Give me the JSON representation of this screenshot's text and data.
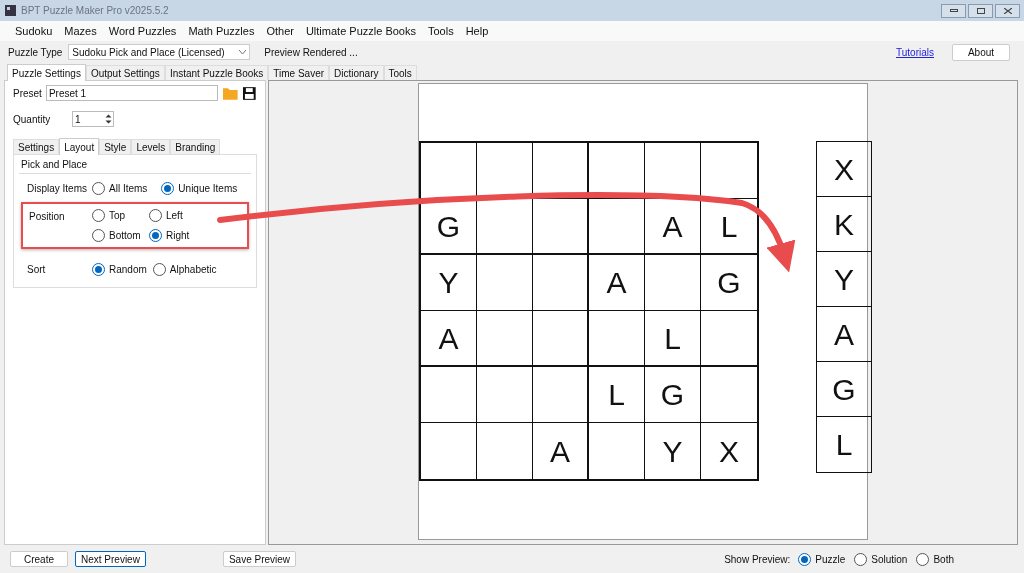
{
  "window": {
    "title": "BPT Puzzle Maker Pro v2025.5.2"
  },
  "menu": [
    "Sudoku",
    "Mazes",
    "Word Puzzles",
    "Math Puzzles",
    "Other",
    "Ultimate Puzzle Books",
    "Tools",
    "Help"
  ],
  "toolbar": {
    "puzzle_type_label": "Puzzle Type",
    "puzzle_type": "Sudoku Pick and Place (Licensed)",
    "status": "Preview Rendered ...",
    "tutorials_link": "Tutorials",
    "about_button": "About"
  },
  "main_tabs": [
    {
      "label": "Puzzle Settings",
      "selected": true
    },
    {
      "label": "Output Settings",
      "selected": false
    },
    {
      "label": "Instant Puzzle Books",
      "selected": false
    },
    {
      "label": "Time Saver",
      "selected": false
    },
    {
      "label": "Dictionary",
      "selected": false
    },
    {
      "label": "Tools",
      "selected": false
    }
  ],
  "preset": {
    "label": "Preset",
    "value": "Preset 1"
  },
  "quantity": {
    "label": "Quantity",
    "value": "1"
  },
  "sub_tabs": [
    {
      "label": "Settings",
      "selected": false
    },
    {
      "label": "Layout",
      "selected": true
    },
    {
      "label": "Style",
      "selected": false
    },
    {
      "label": "Levels",
      "selected": false
    },
    {
      "label": "Branding",
      "selected": false
    }
  ],
  "group": {
    "title": "Pick and Place",
    "display_items": {
      "label": "Display Items",
      "options": [
        {
          "label": "All Items",
          "selected": false
        },
        {
          "label": "Unique Items",
          "selected": true
        }
      ]
    },
    "position": {
      "label": "Position",
      "highlighted": true,
      "options": [
        {
          "label": "Top",
          "selected": false
        },
        {
          "label": "Left",
          "selected": false
        },
        {
          "label": "Bottom",
          "selected": false
        },
        {
          "label": "Right",
          "selected": true
        }
      ]
    },
    "sort": {
      "label": "Sort",
      "options": [
        {
          "label": "Random",
          "selected": true
        },
        {
          "label": "Alphabetic",
          "selected": false
        }
      ]
    }
  },
  "puzzle": {
    "grid": [
      [
        {
          "kind": "blank"
        },
        {
          "kind": "blank"
        },
        {
          "kind": "blank"
        },
        {
          "kind": "blank"
        },
        {
          "kind": "blank"
        },
        {
          "kind": "blank"
        }
      ],
      [
        {
          "kind": "given",
          "letter": "G"
        },
        {
          "kind": "blank"
        },
        {
          "kind": "blank"
        },
        {
          "kind": "blank"
        },
        {
          "kind": "given",
          "letter": "A"
        },
        {
          "kind": "given",
          "letter": "L"
        }
      ],
      [
        {
          "kind": "given",
          "letter": "Y"
        },
        {
          "kind": "blank"
        },
        {
          "kind": "blank"
        },
        {
          "kind": "given",
          "letter": "A"
        },
        {
          "kind": "blank"
        },
        {
          "kind": "given",
          "letter": "G"
        }
      ],
      [
        {
          "kind": "given",
          "letter": "A"
        },
        {
          "kind": "blank"
        },
        {
          "kind": "blank"
        },
        {
          "kind": "blank"
        },
        {
          "kind": "given",
          "letter": "L"
        },
        {
          "kind": "blank"
        }
      ],
      [
        {
          "kind": "blank"
        },
        {
          "kind": "blank"
        },
        {
          "kind": "blank"
        },
        {
          "kind": "given",
          "letter": "L"
        },
        {
          "kind": "given",
          "letter": "G"
        },
        {
          "kind": "blank"
        }
      ],
      [
        {
          "kind": "blank"
        },
        {
          "kind": "blank"
        },
        {
          "kind": "given",
          "letter": "A"
        },
        {
          "kind": "blank"
        },
        {
          "kind": "given",
          "letter": "Y"
        },
        {
          "kind": "given",
          "letter": "X"
        }
      ]
    ],
    "items": [
      "X",
      "K",
      "Y",
      "A",
      "G",
      "L"
    ]
  },
  "bottom": {
    "buttons": [
      {
        "label": "Create",
        "focused": false
      },
      {
        "label": "Next Preview",
        "focused": true
      }
    ],
    "save_button": "Save Preview",
    "show_preview_label": "Show Preview:",
    "show_preview": [
      {
        "label": "Puzzle",
        "selected": true
      },
      {
        "label": "Solution",
        "selected": false
      },
      {
        "label": "Both",
        "selected": false
      }
    ]
  }
}
